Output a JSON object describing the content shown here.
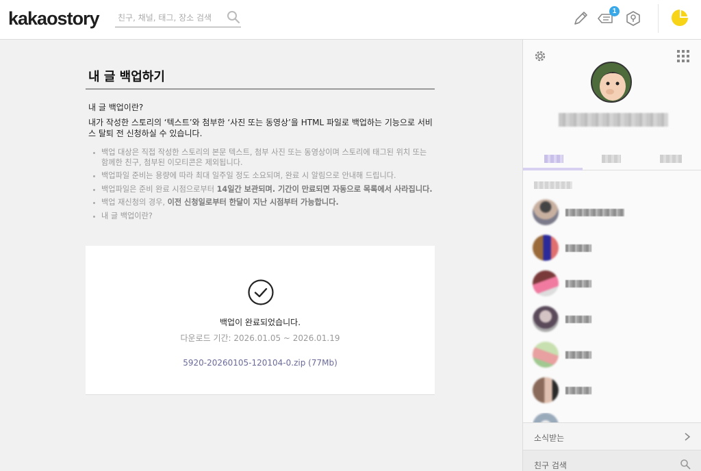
{
  "header": {
    "logo": "kakaostory",
    "search_placeholder": "친구, 채널, 태그, 장소 검색",
    "notification_count": "1",
    "icons": [
      "search-icon",
      "pencil-icon",
      "notification-icon",
      "location-icon",
      "profile-character-icon"
    ]
  },
  "main": {
    "title": "내 글 백업하기",
    "intro_question": "내 글 백업이란?",
    "intro_text": "내가 작성한 스토리의 ‘텍스트’와 첨부한 ‘사진 또는 동영상’을 HTML 파일로 백업하는 기능으로 서비스 탈퇴 전 신청하실 수 있습니다.",
    "notes": [
      {
        "plain": "백업 대상은 직접 작성한 스토리의 본문 텍스트, 첨부 사진 또는 동영상이며 스토리에 태그된 위치 또는 함께한 친구, 첨부된 이모티콘은 제외됩니다.",
        "bold": "",
        "after": ""
      },
      {
        "plain": "백업파일 준비는 용량에 따라 최대 일주일 정도 소요되며, 완료 시 알림으로 안내해 드립니다.",
        "bold": "",
        "after": ""
      },
      {
        "plain": "백업파일은 준비 완료 시점으로부터 ",
        "bold": "14일간 보관되며. 기간이 만료되면 자동으로 목록에서 사라집니다.",
        "after": ""
      },
      {
        "plain": "백업 재신청의 경우, ",
        "bold": "이전 신청일로부터 한달이 지난 시점부터 가능합니다.",
        "after": ""
      },
      {
        "plain": "내 글 백업이란?",
        "bold": "",
        "after": ""
      }
    ],
    "result": {
      "done": "백업이 완료되었습니다.",
      "period": "다운로드 기간: 2026.01.05 ~ 2026.01.19",
      "file": "5920-20260105-120104-0.zip (77Mb)"
    }
  },
  "sidebar": {
    "follow_label": "소식받는",
    "friend_search_label": "친구 검색",
    "colors": {
      "tab_active": "#d8d0f0",
      "accent": "#38a8e8"
    }
  }
}
